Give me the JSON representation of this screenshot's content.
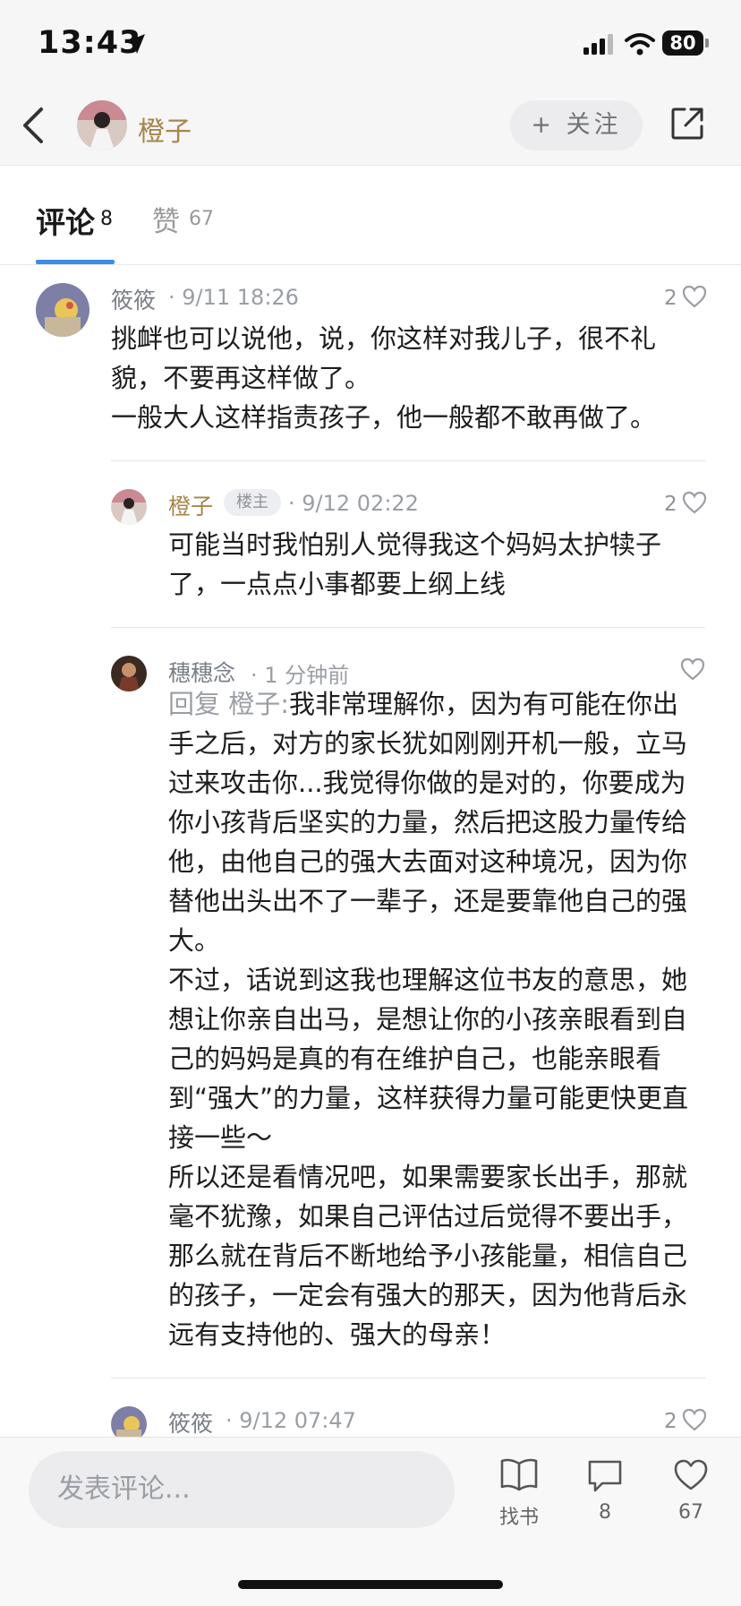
{
  "status_bar": {
    "time": "13:43",
    "battery": "80"
  },
  "header": {
    "back_icon": "chevron-left-icon",
    "author_name": "橙子",
    "follow_label": "+ 关注",
    "share_icon": "share-icon"
  },
  "tabs": [
    {
      "label": "评论",
      "count": "8"
    },
    {
      "label": "赞",
      "count": "67"
    }
  ],
  "comments": [
    {
      "name": "筱筱",
      "meta": "· 9/11 18:26",
      "likes": "2",
      "text": "挑衅也可以说他，说，你这样对我儿子，很不礼貌，不要再这样做了。\n一般大人这样指责孩子，他一般都不敢再做了。"
    },
    {
      "name": "橙子",
      "badge": "楼主",
      "meta": "· 9/12 02:22",
      "likes": "2",
      "text": "可能当时我怕别人觉得我这个妈妈太护犊子了，一点点小事都要上纲上线"
    },
    {
      "name": "穗穗念",
      "meta": "· 1 分钟前",
      "likes": "",
      "reply_prefix": "回复 橙子:",
      "text": "我非常理解你，因为有可能在你出手之后，对方的家长犹如刚刚开机一般，立马过来攻击你...我觉得你做的是对的，你要成为你小孩背后坚实的力量，然后把这股力量传给他，由他自己的强大去面对这种境况，因为你替他出头出不了一辈子，还是要靠他自己的强大。\n不过，话说到这我也理解这位书友的意思，她想让你亲自出马，是想让你的小孩亲眼看到自己的妈妈是真的有在维护自己，也能亲眼看到“强大”的力量，这样获得力量可能更快更直接一些～\n所以还是看情况吧，如果需要家长出手，那就毫不犹豫，如果自己评估过后觉得不要出手，那么就在背后不断地给予小孩能量，相信自己的孩子，一定会有强大的那天，因为他背后永远有支持他的、强大的母亲！"
    },
    {
      "name": "筱筱",
      "meta": "· 9/12 07:47",
      "likes": "2"
    }
  ],
  "bottom_bar": {
    "input_placeholder": "发表评论...",
    "find_book_label": "找书",
    "comment_count": "8",
    "like_count": "67"
  },
  "colors": {
    "accent_blue": "#3a8ee6",
    "author_gold": "#a6864a",
    "meta_gray": "#9a9ea4"
  }
}
